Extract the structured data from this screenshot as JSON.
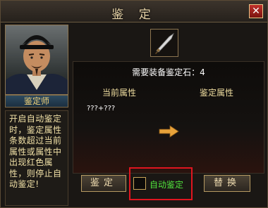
{
  "window": {
    "title": "鉴 定"
  },
  "npc": {
    "name": "鉴定师"
  },
  "description": "开启自动鉴定时，鉴定属性条数超过当前属性或属性中出现红色属性，则停止自动鉴定!",
  "required_stones_label": "需要装备鉴定石：4",
  "current_attr_header": "当前属性",
  "identified_attr_header": "鉴定属性",
  "current_attr_value": "???+???",
  "buttons": {
    "identify": "鉴定",
    "auto_identify": "自动鉴定",
    "replace": "替换"
  },
  "auto_identify_checked": false,
  "icons": {
    "close": "close-icon",
    "weapon": "sword-icon",
    "arrow": "arrow-right-icon"
  },
  "colors": {
    "auto_label": "#50e13c",
    "highlight_box": "#e0151f",
    "attr_header": "#f0dea0"
  }
}
